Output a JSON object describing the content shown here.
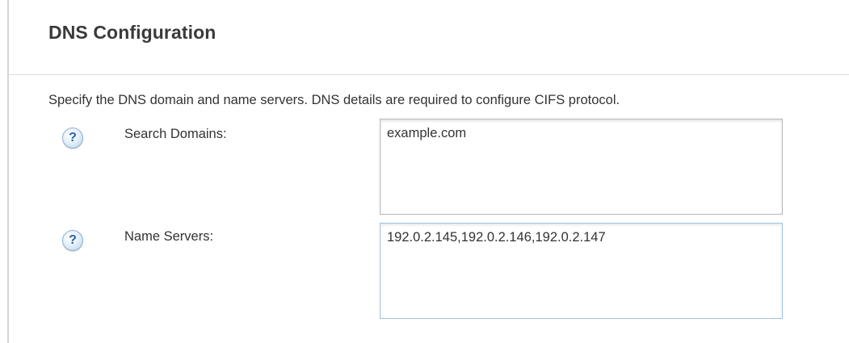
{
  "section": {
    "title": "DNS Configuration",
    "description": "Specify the DNS domain and name servers. DNS details are required to configure CIFS protocol."
  },
  "help_icon_glyph": "?",
  "fields": [
    {
      "label": "Search Domains:",
      "value": "example.com",
      "icon": "help-icon"
    },
    {
      "label": "Name Servers:",
      "value": "192.0.2.145,192.0.2.146,192.0.2.147",
      "icon": "help-icon"
    }
  ],
  "colors": {
    "help_icon_blue": "#2a62a8",
    "focused_border": "#9fc4e4"
  }
}
